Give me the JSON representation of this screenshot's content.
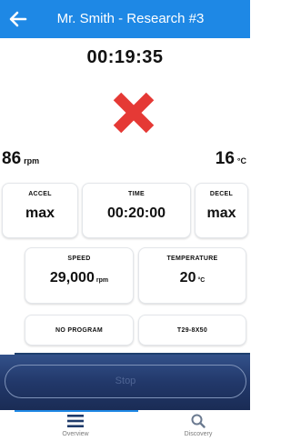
{
  "header": {
    "title": "Mr. Smith - Research #3",
    "back_icon": "arrow-left-icon",
    "color": "#1e88e5"
  },
  "timer": "00:19:35",
  "status_icon": {
    "name": "error-x-icon",
    "color": "#e53935"
  },
  "readouts": {
    "speed": {
      "value": "86",
      "unit": "rpm"
    },
    "temperature": {
      "value": "16",
      "unit": "°C"
    }
  },
  "cards": {
    "accel": {
      "label": "ACCEL",
      "value": "max"
    },
    "time": {
      "label": "TIME",
      "value": "00:20:00"
    },
    "decel": {
      "label": "DECEL",
      "value": "max"
    },
    "speed": {
      "label": "SPEED",
      "value": "29,000",
      "unit": "rpm"
    },
    "temperature": {
      "label": "TEMPERATURE",
      "value": "20",
      "unit": "°C"
    },
    "program": {
      "label": "NO PROGRAM"
    },
    "rotor": {
      "label": "T29-8X50"
    }
  },
  "stop_button": {
    "label": "Stop"
  },
  "tabs": [
    {
      "label": "Overview",
      "icon": "menu-icon",
      "active": true
    },
    {
      "label": "Discovery",
      "icon": "search-icon",
      "active": false
    }
  ]
}
